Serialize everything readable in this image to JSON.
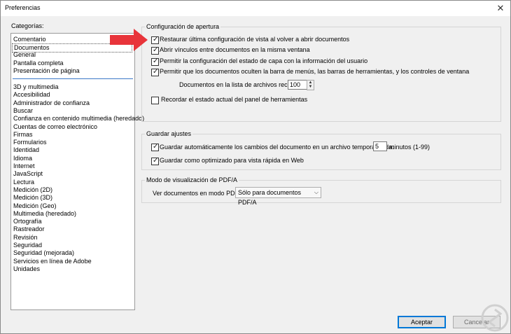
{
  "window": {
    "title": "Preferencias",
    "close_glyph": "✕"
  },
  "categories": {
    "label": "Categorías:",
    "top_items": [
      "Comentario",
      "Documentos",
      "General",
      "Pantalla completa",
      "Presentación de página"
    ],
    "selected_index": 1,
    "items": [
      "3D y multimedia",
      "Accesibilidad",
      "Administrador de confianza",
      "Buscar",
      "Confianza en contenido multimedia (heredado)",
      "Cuentas de correo electrónico",
      "Firmas",
      "Formularios",
      "Identidad",
      "Idioma",
      "Internet",
      "JavaScript",
      "Lectura",
      "Medición (2D)",
      "Medición (3D)",
      "Medición (Geo)",
      "Multimedia (heredado)",
      "Ortografía",
      "Rastreador",
      "Revisión",
      "Seguridad",
      "Seguridad (mejorada)",
      "Servicios en línea de Adobe",
      "Unidades"
    ]
  },
  "apertura": {
    "title": "Configuración de apertura",
    "options": [
      {
        "label": "Restaurar última configuración de vista al volver a abrir documentos",
        "checked": true
      },
      {
        "label": "Abrir vínculos entre documentos en la misma ventana",
        "checked": true
      },
      {
        "label": "Permitir la configuración del estado de capa con la información del usuario",
        "checked": true
      },
      {
        "label": "Permitir que los documentos oculten la barra de menús, las barras de herramientas, y los controles de ventana",
        "checked": true
      }
    ],
    "recent_label": "Documentos en la lista de archivos recientes:",
    "recent_value": "100",
    "remember_label": "Recordar el estado actual del panel de herramientas",
    "remember_checked": false
  },
  "guardar": {
    "title": "Guardar ajustes",
    "autosave_label": "Guardar automáticamente los cambios del documento en un archivo temporal cada:",
    "autosave_checked": true,
    "autosave_value": "5",
    "autosave_unit": "minutos (1-99)",
    "fastweb_label": "Guardar como optimizado para vista rápida en Web",
    "fastweb_checked": true
  },
  "pdfa": {
    "title": "Modo de visualización de PDF/A",
    "view_label": "Ver documentos en modo PDF/A:",
    "view_value": "Sólo para documentos PDF/A"
  },
  "footer": {
    "accept_label": "Aceptar",
    "cancel_label": "Cancelar"
  },
  "colors": {
    "highlight_arrow": "#e8343a",
    "divider": "#3c78c8",
    "primary_border": "#0078d7"
  }
}
